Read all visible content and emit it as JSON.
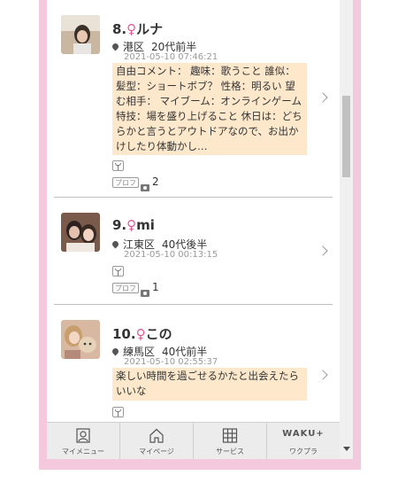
{
  "colors": {
    "frame": "#f4c8dd",
    "comment_bg": "#fde8cc",
    "female_symbol": "#e05a9a",
    "date_text": "#999999"
  },
  "items": [
    {
      "rank": "8.",
      "symbol": "♀",
      "name": "ルナ",
      "area": "港区",
      "age": "20代前半",
      "datetime": "2021-05-10 07:46:21",
      "comment": "自由コメント： 趣味：歌うこと 誰似：髪型：ショートボブ？ 性格：明るい 望む相手： マイブーム：オンラインゲーム 特技：場を盛り上げること 休日は：どちらかと言うとアウトドアなので、お出かけしたり体動かし…",
      "prof_label": "プロフ",
      "photo_count": "2"
    },
    {
      "rank": "9.",
      "symbol": "♀",
      "name": "mi",
      "area": "江東区",
      "age": "40代後半",
      "datetime": "2021-05-10 00:13:15",
      "prof_label": "プロフ",
      "photo_count": "1"
    },
    {
      "rank": "10.",
      "symbol": "♀",
      "name": "この",
      "area": "練馬区",
      "age": "40代前半",
      "datetime": "2021-05-10 02:55:37",
      "comment": "楽しい時間を過ごせるかたと出会えたらいいな"
    }
  ],
  "footer": {
    "my_menu": "マイメニュー",
    "my_page": "マイページ",
    "service": "サービス",
    "waku_logo": "WAKU+",
    "waku_label": "ワクプラ"
  },
  "icons": {
    "location": "location-pin-icon",
    "glass": "cocktail-glass-icon",
    "camera": "camera-icon",
    "chevron": "chevron-right-icon"
  }
}
